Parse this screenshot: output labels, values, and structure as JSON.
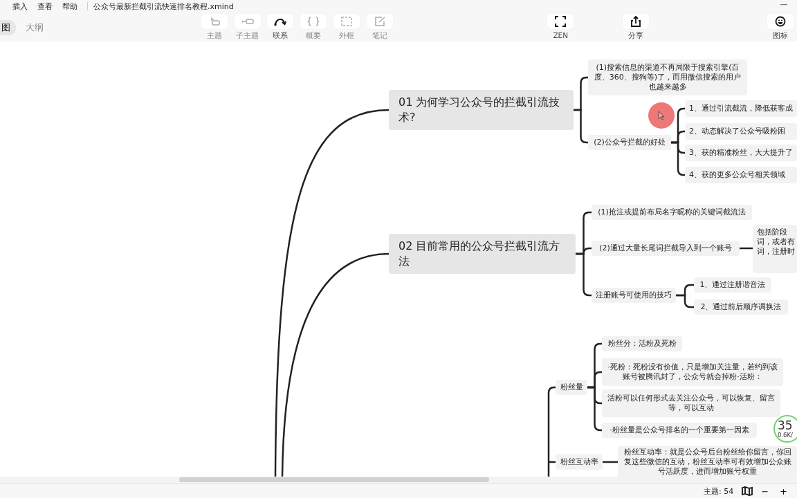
{
  "menu": [
    "插入",
    "查看",
    "帮助"
  ],
  "file_title": "公众号最新拦截引流快速排名教程.xmind",
  "view_tabs": [
    {
      "label": "图",
      "selected": true
    },
    {
      "label": "大纲",
      "selected": false
    }
  ],
  "toolbar": [
    {
      "label": "主题",
      "kind": "topic",
      "disabled": true
    },
    {
      "label": "子主题",
      "kind": "subtopic",
      "disabled": true
    },
    {
      "label": "联系",
      "kind": "relation",
      "disabled": false
    },
    {
      "label": "概要",
      "kind": "summary",
      "disabled": true
    },
    {
      "label": "外框",
      "kind": "boundary",
      "disabled": true
    },
    {
      "label": "笔记",
      "kind": "note",
      "disabled": true
    }
  ],
  "right_tools": [
    {
      "label": "ZEN",
      "kind": "zen"
    },
    {
      "label": "分享",
      "kind": "share"
    },
    {
      "label": "图标",
      "kind": "emoji"
    }
  ],
  "topics": [
    {
      "text": "01 为何学习公众号的拦截引流技术?",
      "children": [
        {
          "text": "(1)搜索信息的渠道不再局限于搜索引擎(百度、360、搜狗等)了，而用微信搜索的用户也越来越多"
        },
        {
          "text": "(2)公众号拦截的好处",
          "children": [
            {
              "text": "1、通过引流截流，降低获客成"
            },
            {
              "text": "2、动态解决了公众号吸粉困"
            },
            {
              "text": "3、获的精准粉丝，大大提升了"
            },
            {
              "text": "4、获的更多公众号相关领域"
            }
          ]
        }
      ]
    },
    {
      "text": "02 目前常用的公众号拦截引流方法",
      "children": [
        {
          "text": "(1)抢注或提前布局名字昵称的关键词截流法"
        },
        {
          "text": "(2)通过大量长尾词拦截导入到一个账号",
          "children": [
            {
              "lines": [
                "包括阶段",
                "词，或者有",
                "词，注册时"
              ]
            }
          ]
        },
        {
          "text": "注册账号可使用的技巧",
          "children": [
            {
              "text": "1、通过注册谐音法"
            },
            {
              "text": "2、通过前后顺序调换法"
            }
          ]
        }
      ]
    },
    {
      "children": [
        {
          "text": "粉丝量",
          "children": [
            {
              "text": "粉丝分：活粉及死粉"
            },
            {
              "text": "·死粉：死粉没有价值，只是增加关注量，若约到该账号被腾讯封了，公众号就会掉粉·活粉："
            },
            {
              "text": "活粉可以任何形式去关注公众号，可以恢复、留言等，可以互动"
            },
            {
              "text": "·粉丝量是公众号排名的一个重要第一因素"
            }
          ]
        },
        {
          "text": "粉丝互动率",
          "children": [
            {
              "text": "粉丝互动率：就是公众号后台粉丝给你留言，你回复这些微信的互动，粉丝互动率可有效增加公众账号活跃度，进而增加账号权重"
            }
          ]
        }
      ]
    }
  ],
  "speed_widget": {
    "value": "35",
    "rate": "0.6K/"
  },
  "status_bar": {
    "topic_count": "主题: 54",
    "zoom_out": "−",
    "zoom_in": "+"
  }
}
